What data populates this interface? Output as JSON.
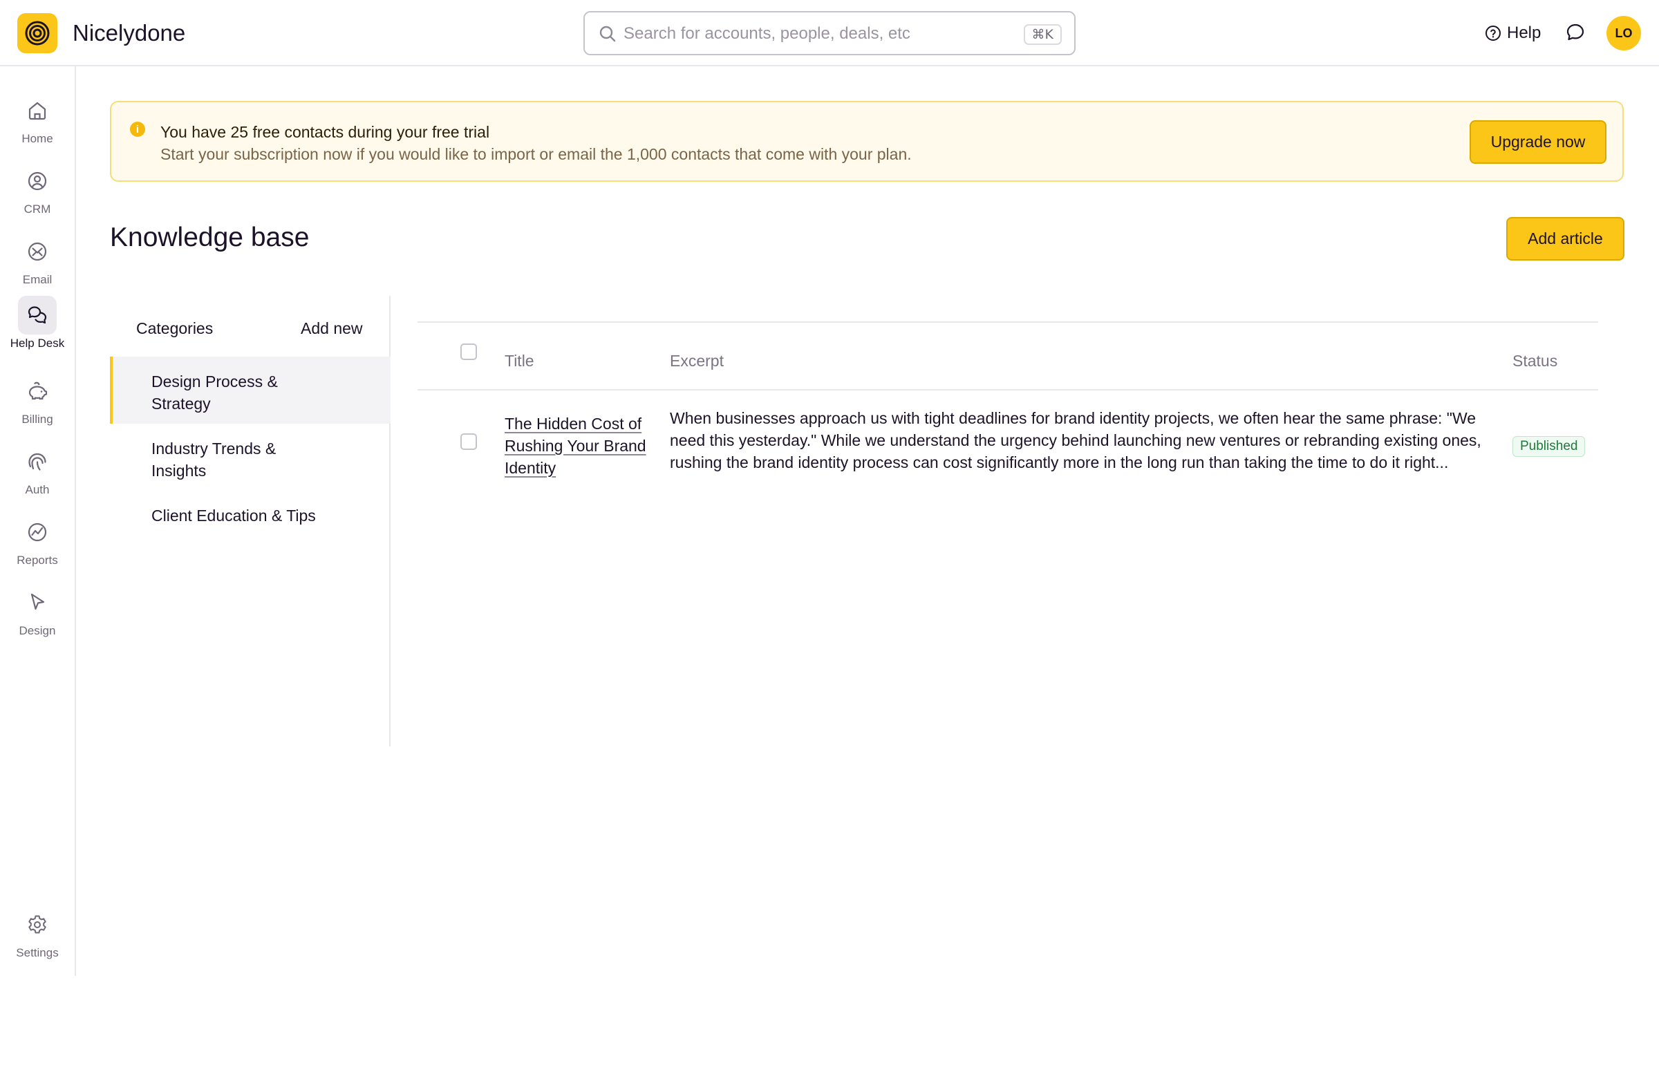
{
  "app": {
    "name": "Nicelydone",
    "brand_color": "#fbc618"
  },
  "topbar": {
    "search_placeholder": "Search for accounts, people, deals, etc",
    "search_shortcut": "⌘K",
    "help_label": "Help",
    "avatar_initials": "LO"
  },
  "sidebar": {
    "items": [
      {
        "label": "Home",
        "icon": "home-icon"
      },
      {
        "label": "CRM",
        "icon": "user-circle-icon"
      },
      {
        "label": "Email",
        "icon": "mail-icon"
      },
      {
        "label": "Help Desk",
        "icon": "chat-bubbles-icon",
        "active": true
      },
      {
        "label": "Billing",
        "icon": "piggy-bank-icon"
      },
      {
        "label": "Auth",
        "icon": "fingerprint-icon"
      },
      {
        "label": "Reports",
        "icon": "chart-icon"
      },
      {
        "label": "Design",
        "icon": "cursor-icon"
      }
    ],
    "settings_label": "Settings"
  },
  "banner": {
    "title": "You have 25 free contacts during your free trial",
    "description": "Start your subscription now if you would like to import or email the 1,000 contacts that come with your plan.",
    "button_label": "Upgrade now"
  },
  "page": {
    "title": "Knowledge base",
    "add_button_label": "Add article"
  },
  "categories": {
    "heading": "Categories",
    "add_label": "Add new",
    "items": [
      {
        "line1": "Design Process &",
        "line2": "Strategy",
        "active": true
      },
      {
        "line1": "Industry Trends &",
        "line2": "Insights"
      },
      {
        "line1": "Client Education & Tips",
        "line2": ""
      }
    ]
  },
  "table": {
    "columns": [
      "Title",
      "Excerpt",
      "Status"
    ],
    "rows": [
      {
        "title_line1": "The Hidden Cost of",
        "title_line2": "Rushing Your Brand",
        "title_line3": "Identity",
        "excerpt_line1": "When businesses approach us with tight deadlines for brand identity projects, we often hear the same phrase: \"We",
        "excerpt_line2": "need this yesterday.\" While we understand the urgency behind launching new ventures or rebranding existing ones,",
        "excerpt_line3": "rushing the brand identity process can cost significantly more in the long run than taking the time to do it right...",
        "status": "Published"
      }
    ]
  }
}
